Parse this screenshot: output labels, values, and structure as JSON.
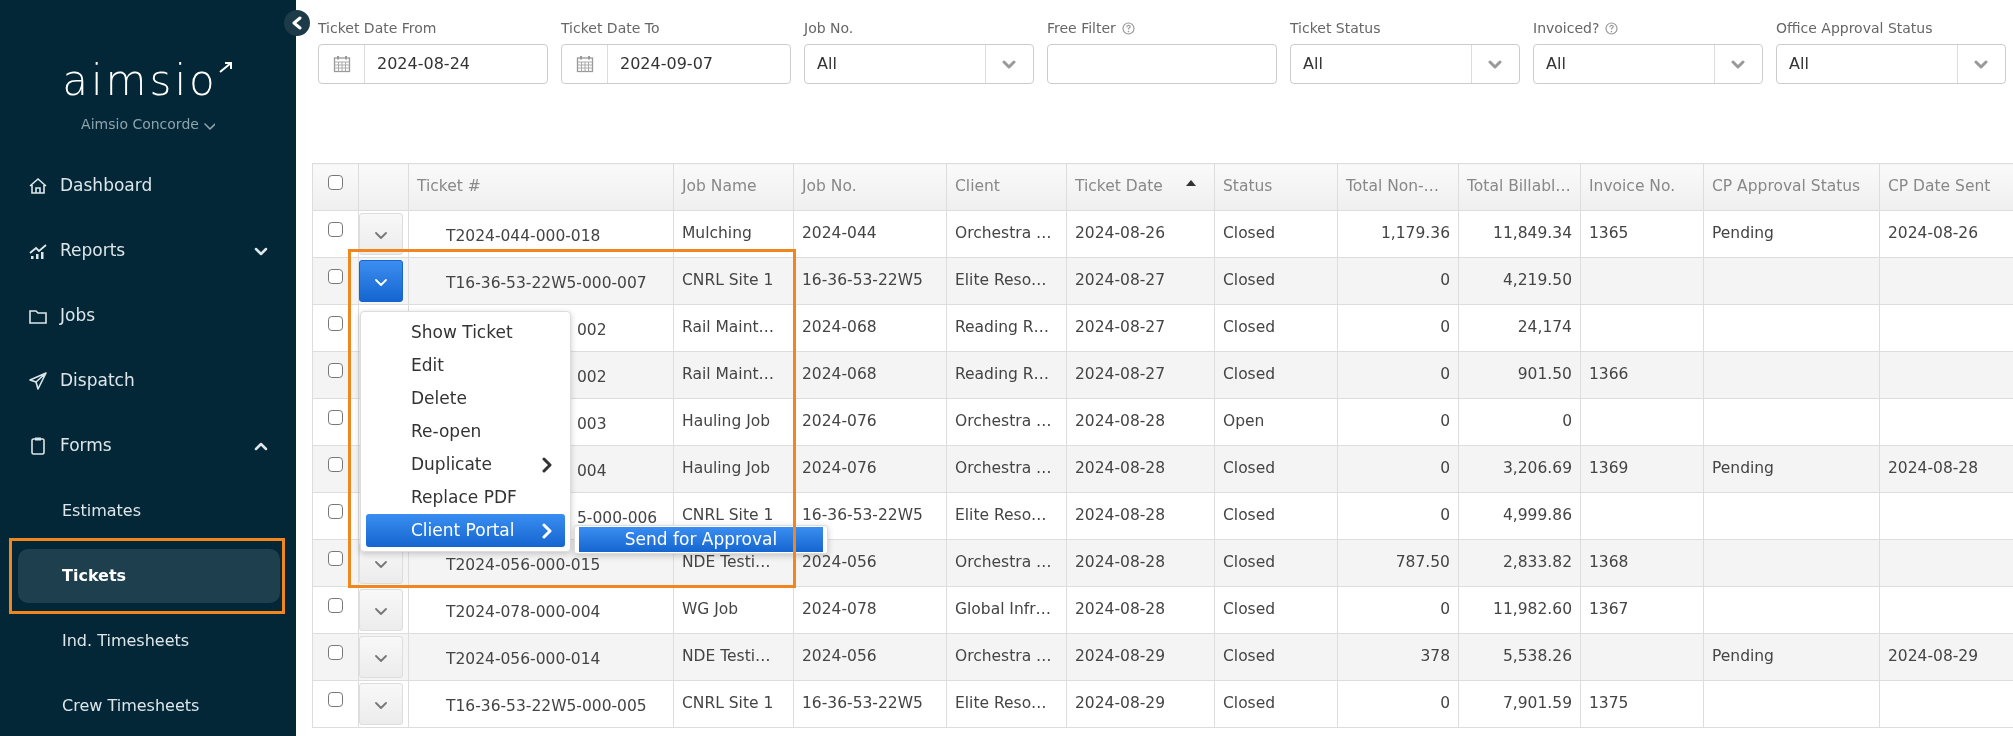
{
  "sidebar": {
    "logo": "aimsio",
    "company": "Aimsio Concorde",
    "items": [
      {
        "label": "Dashboard",
        "kind": "link"
      },
      {
        "label": "Reports",
        "kind": "group",
        "expanded": false
      },
      {
        "label": "Jobs",
        "kind": "link"
      },
      {
        "label": "Dispatch",
        "kind": "link"
      },
      {
        "label": "Forms",
        "kind": "group",
        "expanded": true,
        "children": [
          {
            "label": "Estimates",
            "selected": false
          },
          {
            "label": "Tickets",
            "selected": true
          },
          {
            "label": "Ind. Timesheets",
            "selected": false
          },
          {
            "label": "Crew Timesheets",
            "selected": false
          }
        ]
      }
    ]
  },
  "filters": [
    {
      "label": "Ticket Date From",
      "kind": "date",
      "value": "2024-08-24"
    },
    {
      "label": "Ticket Date To",
      "kind": "date",
      "value": "2024-09-07"
    },
    {
      "label": "Job No.",
      "kind": "select",
      "value": "All"
    },
    {
      "label": "Free Filter",
      "kind": "text",
      "help": true
    },
    {
      "label": "Ticket Status",
      "kind": "select",
      "value": "All"
    },
    {
      "label": "Invoiced?",
      "kind": "select",
      "value": "All",
      "help": true
    },
    {
      "label": "Office Approval Status",
      "kind": "select",
      "value": "All"
    }
  ],
  "table": {
    "all_checked": false,
    "columns": [
      {
        "label": "Ticket #",
        "kind": "text"
      },
      {
        "label": "Job Name",
        "kind": "text"
      },
      {
        "label": "Job No.",
        "kind": "text"
      },
      {
        "label": "Client",
        "kind": "text"
      },
      {
        "label": "Ticket Date",
        "kind": "text",
        "sorted": true
      },
      {
        "label": "Status",
        "kind": "text"
      },
      {
        "label": "Total Non-…",
        "kind": "number"
      },
      {
        "label": "Total Billabl…",
        "kind": "number"
      },
      {
        "label": "Invoice No.",
        "kind": "text"
      },
      {
        "label": "CP Approval Status",
        "kind": "text"
      },
      {
        "label": "CP Date Sent",
        "kind": "text"
      }
    ],
    "rows": [
      {
        "checked": false,
        "menu_open": false,
        "cells": [
          "T2024-044-000-018",
          "Mulching",
          "2024-044",
          "Orchestra …",
          "2024-08-26",
          "Closed",
          "1,179.36",
          "11,849.34",
          "1365",
          "Pending",
          "2024-08-26"
        ]
      },
      {
        "checked": false,
        "menu_open": true,
        "cells": [
          "T16-36-53-22W5-000-007",
          "CNRL Site 1",
          "16-36-53-22W5",
          "Elite Reso…",
          "2024-08-27",
          "Closed",
          "0",
          "4,219.50",
          null,
          null,
          null
        ]
      },
      {
        "checked": false,
        "ticket_covered": true,
        "cells": [
          "002",
          "Rail Maint…",
          "2024-068",
          "Reading R…",
          "2024-08-27",
          "Closed",
          "0",
          "24,174",
          null,
          null,
          null
        ]
      },
      {
        "checked": false,
        "ticket_covered": true,
        "cells": [
          "002",
          "Rail Maint…",
          "2024-068",
          "Reading R…",
          "2024-08-27",
          "Closed",
          "0",
          "901.50",
          "1366",
          null,
          null
        ]
      },
      {
        "checked": false,
        "ticket_covered": true,
        "cells": [
          "003",
          "Hauling Job",
          "2024-076",
          "Orchestra …",
          "2024-08-28",
          "Open",
          "0",
          "0",
          null,
          null,
          null
        ]
      },
      {
        "checked": false,
        "ticket_covered": true,
        "cells": [
          "004",
          "Hauling Job",
          "2024-076",
          "Orchestra …",
          "2024-08-28",
          "Closed",
          "0",
          "3,206.69",
          "1369",
          "Pending",
          "2024-08-28"
        ]
      },
      {
        "checked": false,
        "ticket_covered": true,
        "cells": [
          "5-000-006",
          "CNRL Site 1",
          "16-36-53-22W5",
          "Elite Reso…",
          "2024-08-28",
          "Closed",
          "0",
          "4,999.86",
          null,
          null,
          null
        ]
      },
      {
        "checked": false,
        "menu_open": false,
        "cells": [
          "T2024-056-000-015",
          "NDE Testi…",
          "2024-056",
          "Orchestra …",
          "2024-08-28",
          "Closed",
          "787.50",
          "2,833.82",
          "1368",
          null,
          null
        ]
      },
      {
        "checked": false,
        "menu_open": false,
        "cells": [
          "T2024-078-000-004",
          "WG Job",
          "2024-078",
          "Global Infr…",
          "2024-08-28",
          "Closed",
          "0",
          "11,982.60",
          "1367",
          null,
          null
        ]
      },
      {
        "checked": false,
        "menu_open": false,
        "cells": [
          "T2024-056-000-014",
          "NDE Testi…",
          "2024-056",
          "Orchestra …",
          "2024-08-29",
          "Closed",
          "378",
          "5,538.26",
          null,
          "Pending",
          "2024-08-29"
        ]
      },
      {
        "checked": false,
        "menu_open": false,
        "cells": [
          "T16-36-53-22W5-000-005",
          "CNRL Site 1",
          "16-36-53-22W5",
          "Elite Reso…",
          "2024-08-29",
          "Closed",
          "0",
          "7,901.59",
          "1375",
          null,
          null
        ]
      }
    ]
  },
  "row_menu": {
    "items": [
      {
        "label": "Show Ticket",
        "selected": false,
        "submenu": false
      },
      {
        "label": "Edit",
        "selected": false,
        "submenu": false
      },
      {
        "label": "Delete",
        "selected": false,
        "submenu": false
      },
      {
        "label": "Re-open",
        "selected": false,
        "submenu": false
      },
      {
        "label": "Duplicate",
        "selected": false,
        "submenu": true
      },
      {
        "label": "Replace PDF",
        "selected": false,
        "submenu": false
      },
      {
        "label": "Client Portal",
        "selected": true,
        "submenu": true
      }
    ],
    "submenu": [
      {
        "label": "Send for Approval",
        "selected": true
      }
    ]
  }
}
